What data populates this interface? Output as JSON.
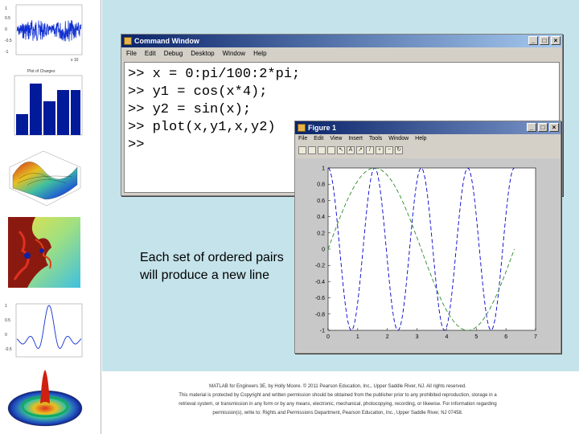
{
  "command_window": {
    "title": "Command Window",
    "menu": [
      "File",
      "Edit",
      "Debug",
      "Desktop",
      "Window",
      "Help"
    ],
    "lines": [
      ">> x = 0:pi/100:2*pi;",
      ">> y1 = cos(x*4);",
      ">> y2 = sin(x);",
      ">> plot(x,y1,x,y2)",
      ">>"
    ]
  },
  "figure_window": {
    "title": "Figure 1",
    "menu": [
      "File",
      "Edit",
      "View",
      "Insert",
      "Tools",
      "Window",
      "Help"
    ],
    "toolbar_icons": [
      "new-icon",
      "open-icon",
      "save-icon",
      "print-icon",
      "pointer-icon",
      "text-icon",
      "arrow-icon",
      "line-icon",
      "zoom-in-icon",
      "zoom-out-icon",
      "rotate-icon"
    ]
  },
  "chart_data": {
    "type": "line",
    "xlim": [
      0,
      7
    ],
    "ylim": [
      -1,
      1
    ],
    "xticks": [
      "0",
      "1",
      "2",
      "3",
      "4",
      "5",
      "6",
      "7"
    ],
    "yticks": [
      "1",
      "0.8",
      "0.6",
      "0.4",
      "0.2",
      "0",
      "-0.2",
      "-0.4",
      "-0.6",
      "-0.8",
      "-1"
    ],
    "series": [
      {
        "expression": "cos(x*4)",
        "color": "#0000cc",
        "dash": "dashed"
      },
      {
        "expression": "sin(x)",
        "color": "#2e8b2e",
        "dash": "dashed"
      }
    ]
  },
  "caption": "Each set of ordered pairs will produce a new line",
  "footer": {
    "line1": "MATLAB for Engineers 3E, by Holly Moore. © 2011 Pearson Education, Inc., Upper Saddle River, NJ. All rights reserved.",
    "line2": "This material is protected by Copyright and written permission should be obtained from the publisher prior to any prohibited reproduction, storage in a",
    "line3": "retrieval system, or transmission in any form or by any means, electronic, mechanical, photocopying, recording, or likewise. For information regarding",
    "line4": "permission(s), write to: Rights and Permissions Department, Pearson Education, Inc., Upper Saddle River, NJ 07458."
  },
  "thumbnails": {
    "t1_yticks": [
      "1",
      "0.5",
      "0",
      "-0.5",
      "-1"
    ],
    "t1_xlabel": "x 10",
    "t2_title": "Plot of Charges",
    "t5_yticks": [
      "1",
      "0.5",
      "0",
      "-0.5"
    ],
    "colors": {
      "signal": "#1030d0",
      "bars": "#001a99"
    }
  }
}
